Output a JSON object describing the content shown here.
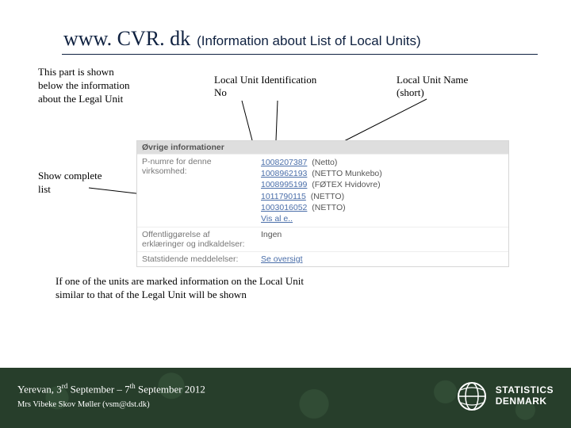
{
  "title": {
    "main": "www. CVR. dk",
    "sub": "(Information about List of Local Units)"
  },
  "notes": {
    "left": "This part is shown below the information about the Legal Unit",
    "center": "Local Unit Identification No",
    "right": "Local Unit Name (short)",
    "showlist": "Show complete list",
    "bottom": "If one of the units are marked information on the Local Unit similar to that of the Legal Unit will be shown"
  },
  "panel": {
    "header": "Øvrige informationer",
    "row1_label": "P-numre for denne virksomhed:",
    "row1_entries": [
      {
        "num": "1008207387",
        "name": "(Netto)"
      },
      {
        "num": "1008962193",
        "name": "(NETTO Munkebo)"
      },
      {
        "num": "1008995199",
        "name": "(FØTEX Hvidovre)"
      },
      {
        "num": "1011790115",
        "name": "(NETTO)"
      },
      {
        "num": "1003016052",
        "name": "(NETTO)"
      }
    ],
    "row1_link": "Vis al e..",
    "row2_label": "Offentliggørelse af erklæringer og indkaldelser:",
    "row2_value": "Ingen",
    "row3_label": "Statstidende meddelelser:",
    "row3_link": "Se oversigt"
  },
  "footer": {
    "line1_pre": "Yerevan, 3",
    "line1_sup1": "rd",
    "line1_mid": " September – 7",
    "line1_sup2": "th",
    "line1_post": " September 2012",
    "line2": "Mrs Vibeke Skov Møller (vsm@dst.dk)",
    "logo_top": "STATISTICS",
    "logo_bot": "DENMARK"
  }
}
